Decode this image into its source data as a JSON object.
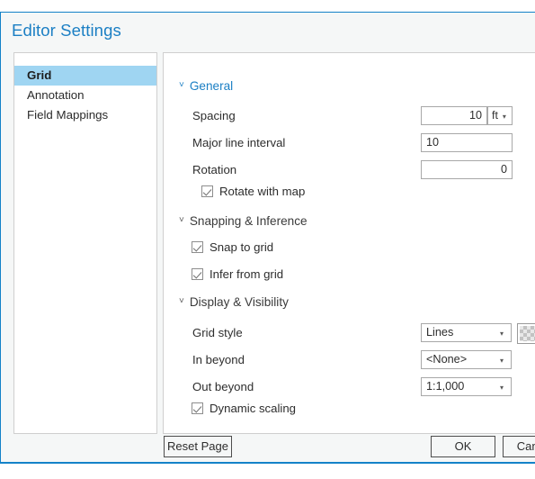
{
  "dialog": {
    "title": "Editor Settings"
  },
  "sidebar": {
    "items": [
      {
        "label": "Grid",
        "selected": true
      },
      {
        "label": "Annotation",
        "selected": false
      },
      {
        "label": "Field Mappings",
        "selected": false
      }
    ]
  },
  "sections": {
    "general": {
      "header": "General",
      "chevron": "chevron-down",
      "chevron_glyph": "˅",
      "fields": {
        "spacing": {
          "label": "Spacing",
          "value": "10",
          "unit": "ft",
          "unit_caret": "▾"
        },
        "major_line_interval": {
          "label": "Major line interval",
          "value": "10"
        },
        "rotation": {
          "label": "Rotation",
          "value": "0"
        },
        "rotate_with_map": {
          "label": "Rotate with map",
          "checked": true
        }
      }
    },
    "snapping": {
      "header": "Snapping & Inference",
      "chevron_glyph": "˅",
      "fields": {
        "snap_to_grid": {
          "label": "Snap to grid",
          "checked": true
        },
        "infer_from_grid": {
          "label": "Infer from grid",
          "checked": true
        }
      }
    },
    "display": {
      "header": "Display & Visibility",
      "chevron_glyph": "˅",
      "fields": {
        "grid_style": {
          "label": "Grid style",
          "value": "Lines",
          "caret": "▾"
        },
        "in_beyond": {
          "label": "In beyond",
          "value": "<None>",
          "caret": "▾"
        },
        "out_beyond": {
          "label": "Out beyond",
          "value": "1:1,000",
          "caret": "▾"
        },
        "dynamic_scaling": {
          "label": "Dynamic scaling",
          "checked": true
        },
        "swatch": {
          "name": "grid-color-swatch"
        }
      }
    }
  },
  "footer": {
    "reset": "Reset Page",
    "ok": "OK",
    "cancel": "Cancel"
  },
  "colors": {
    "accent": "#1482c8",
    "title": "#1b7fc4",
    "selection": "#9fd5f2",
    "panel_bg": "#f5f7f7",
    "content_bg": "#ffffff",
    "border": "#cfcfcf",
    "input_border": "#a8a8a8"
  }
}
